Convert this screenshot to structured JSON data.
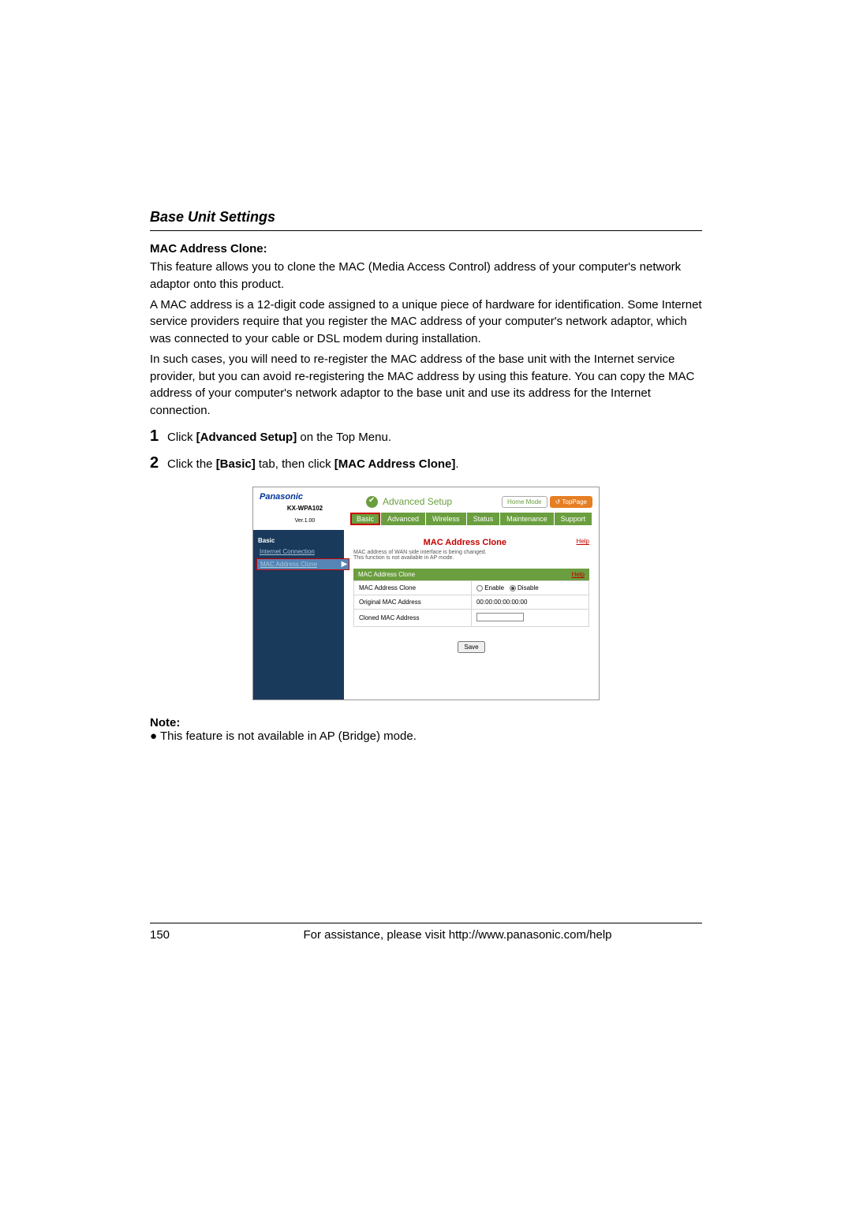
{
  "section_title": "Base Unit Settings",
  "mac_clone": {
    "heading": "MAC Address Clone:",
    "para1": "This feature allows you to clone the MAC (Media Access Control) address of your computer's network adaptor onto this product.",
    "para2": "A MAC address is a 12-digit code assigned to a unique piece of hardware for identification. Some Internet service providers require that you register the MAC address of your computer's network adaptor, which was connected to your cable or DSL modem during installation.",
    "para3": "In such cases, you will need to re-register the MAC address of the base unit with the Internet service provider, but you can avoid re-registering the MAC address by using this feature. You can copy the MAC address of your computer's network adaptor to the base unit and use its address for the Internet connection."
  },
  "steps": {
    "s1_num": "1",
    "s1_pre": "Click ",
    "s1_bold": "[Advanced Setup]",
    "s1_post": " on the Top Menu.",
    "s2_num": "2",
    "s2_pre": "Click the ",
    "s2_bold1": "[Basic]",
    "s2_mid": " tab, then click ",
    "s2_bold2": "[MAC Address Clone]",
    "s2_post": "."
  },
  "screenshot": {
    "logo": "Panasonic",
    "model": "KX-WPA102",
    "version": "Ver.1.00",
    "adv_setup": "Advanced Setup",
    "home_mode": "Home Mode",
    "top_page": "TopPage",
    "tabs": {
      "basic": "Basic",
      "advanced": "Advanced",
      "wireless": "Wireless",
      "status": "Status",
      "maintenance": "Maintenance",
      "support": "Support"
    },
    "sidebar": {
      "group": "Basic",
      "internet": "Internet Connection",
      "mac_clone": "MAC Address Clone"
    },
    "content": {
      "title": "MAC Address Clone",
      "help": "Help",
      "desc1": "MAC address of WAN side interface is being changed.",
      "desc2": "This function is not available in AP mode.",
      "table_header": "MAC Address Clone",
      "row1_label": "MAC Address Clone",
      "row1_enable": "Enable",
      "row1_disable": "Disable",
      "row2_label": "Original MAC Address",
      "row2_value": "00:00:00:00:00:00",
      "row3_label": "Cloned MAC Address",
      "save": "Save"
    }
  },
  "note": {
    "heading": "Note:",
    "bullet_mark": "●",
    "bullet_text": "This feature is not available in AP (Bridge) mode."
  },
  "footer": {
    "page": "150",
    "text": "For assistance, please visit http://www.panasonic.com/help"
  },
  "chart_data": {
    "type": "table",
    "title": "MAC Address Clone",
    "rows": [
      {
        "label": "MAC Address Clone",
        "value": "Enable / Disable (Disable selected)"
      },
      {
        "label": "Original MAC Address",
        "value": "00:00:00:00:00:00"
      },
      {
        "label": "Cloned MAC Address",
        "value": ""
      }
    ]
  }
}
